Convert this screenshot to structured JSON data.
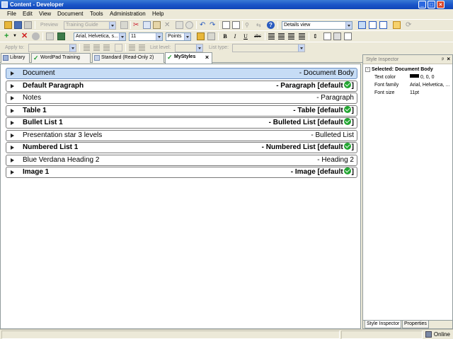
{
  "window": {
    "title": "Content - Developer",
    "controls": [
      "_",
      "□",
      "×"
    ]
  },
  "menu": [
    "File",
    "Edit",
    "View",
    "Document",
    "Tools",
    "Administration",
    "Help"
  ],
  "toolbar": {
    "preview_label": "Preview",
    "guide_combo": "Training Guide",
    "view_combo": "Details view",
    "font_family": "Arial, Helvetica, s...",
    "font_size": "11",
    "size_unit": "Points",
    "bold": "B",
    "italic": "I",
    "underline": "U",
    "strike": "abc",
    "apply_to_label": "Apply to:",
    "list_level_label": "List level:",
    "list_type_label": "List type:"
  },
  "tabs": [
    {
      "label": "Library",
      "active": false
    },
    {
      "label": "WordPad Training",
      "active": false
    },
    {
      "label": "Standard (Read-Only 2)",
      "active": false
    },
    {
      "label": "MyStyles",
      "active": true
    }
  ],
  "styles": [
    {
      "name": "Document",
      "type": "- Document Body",
      "bold": false,
      "default": false,
      "selected": true
    },
    {
      "name": "Default Paragraph",
      "type": "- Paragraph [default",
      "bold": true,
      "default": true,
      "selected": false
    },
    {
      "name": "Notes",
      "type": "- Paragraph",
      "bold": false,
      "default": false,
      "selected": false
    },
    {
      "name": "Table 1",
      "type": "- Table [default",
      "bold": true,
      "default": true,
      "selected": false
    },
    {
      "name": "Bullet List 1",
      "type": "- Bulleted List [default",
      "bold": true,
      "default": true,
      "selected": false
    },
    {
      "name": "Presentation star 3 levels",
      "type": "- Bulleted List",
      "bold": false,
      "default": false,
      "selected": false
    },
    {
      "name": "Numbered List 1",
      "type": "- Numbered List [default",
      "bold": true,
      "default": true,
      "selected": false
    },
    {
      "name": "Blue Verdana Heading 2",
      "type": "- Heading 2",
      "bold": false,
      "default": false,
      "selected": false
    },
    {
      "name": "Image 1",
      "type": "- Image [default",
      "bold": true,
      "default": true,
      "selected": false
    }
  ],
  "default_suffix": "]",
  "inspector": {
    "title": "Style Inspector",
    "pin": "ᵖ",
    "close": "×",
    "minus": "-",
    "selected_label": "Selected: Document Body",
    "properties": [
      {
        "name": "Text color",
        "value": "0, 0, 0",
        "swatch": "#000000"
      },
      {
        "name": "Font family",
        "value": "Arial, Helvetica, ...",
        "swatch": null
      },
      {
        "name": "Font size",
        "value": "11pt",
        "swatch": null
      }
    ],
    "tabs": [
      "Style Inspector",
      "Properties"
    ]
  },
  "status": {
    "connection": "Online"
  },
  "colors": {
    "selected_row": "#c6dcf5",
    "check_green": "#22a531",
    "titlebar_blue": "#1b56c9"
  }
}
